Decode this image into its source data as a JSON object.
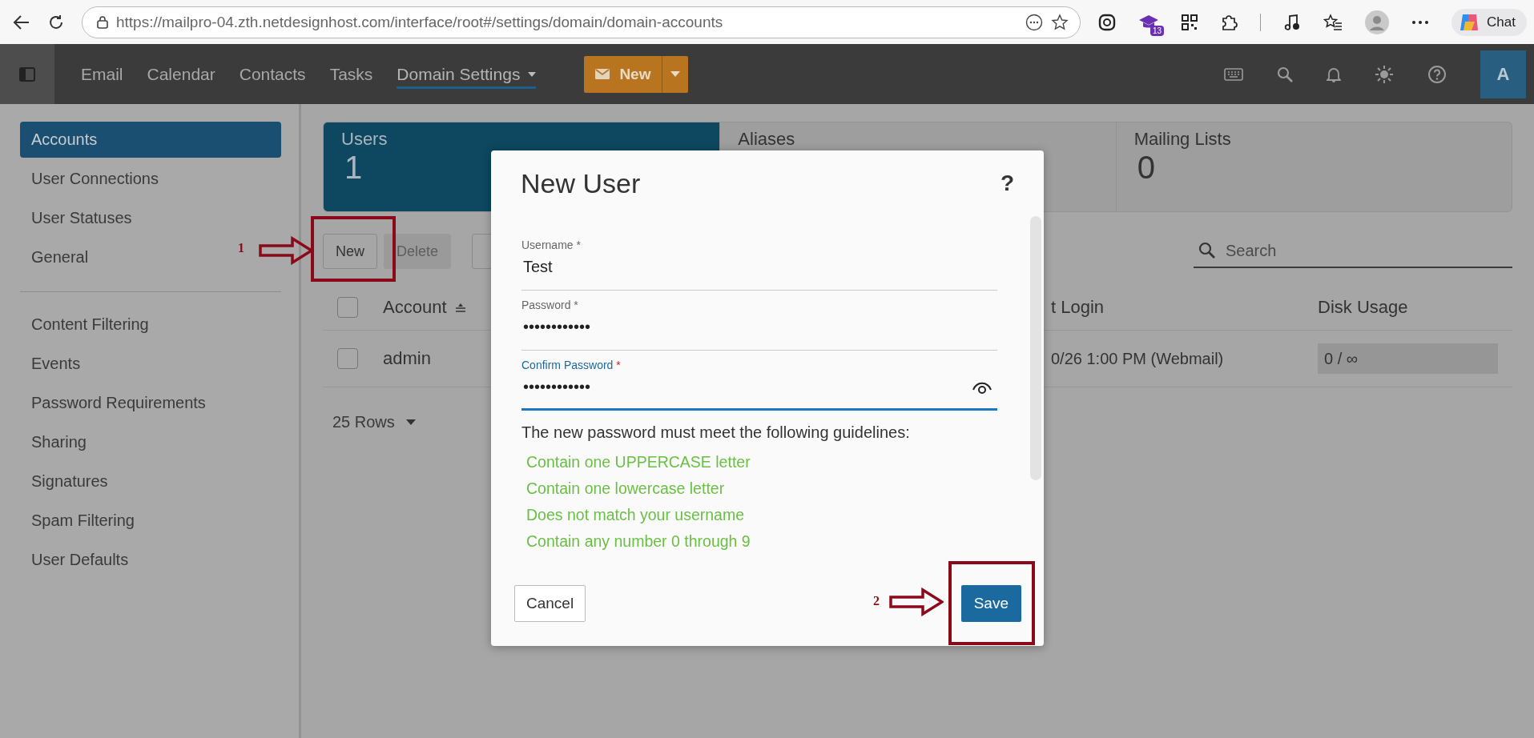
{
  "browser": {
    "url_scheme": "https://",
    "url_host": "mailpro-04.zth.netdesignhost.com",
    "url_path": "/interface/root#/settings/domain/domain-accounts",
    "extension_badge": "13",
    "chat_label": "Chat"
  },
  "nav": {
    "items": [
      {
        "label": "Email",
        "selected": false
      },
      {
        "label": "Calendar",
        "selected": false
      },
      {
        "label": "Contacts",
        "selected": false
      },
      {
        "label": "Tasks",
        "selected": false
      },
      {
        "label": "Domain Settings",
        "selected": true
      }
    ],
    "new_button": "New",
    "avatar": "A"
  },
  "sidebar": {
    "groups": [
      [
        {
          "label": "Accounts",
          "selected": true
        },
        {
          "label": "User Connections",
          "selected": false
        },
        {
          "label": "User Statuses",
          "selected": false
        },
        {
          "label": "General",
          "selected": false
        }
      ],
      [
        {
          "label": "Content Filtering",
          "selected": false
        },
        {
          "label": "Events",
          "selected": false
        },
        {
          "label": "Password Requirements",
          "selected": false
        },
        {
          "label": "Sharing",
          "selected": false
        },
        {
          "label": "Signatures",
          "selected": false
        },
        {
          "label": "Spam Filtering",
          "selected": false
        },
        {
          "label": "User Defaults",
          "selected": false
        }
      ]
    ]
  },
  "stats": [
    {
      "label": "Users",
      "value": "1",
      "selected": true
    },
    {
      "label": "Aliases",
      "selected": false
    },
    {
      "label": "Mailing Lists",
      "value": "0",
      "selected": false
    }
  ],
  "toolbar": {
    "buttons": [
      {
        "label": "New",
        "disabled": false
      },
      {
        "label": "Delete",
        "disabled": true
      }
    ],
    "search": {
      "placeholder": "Search"
    }
  },
  "table": {
    "header_checked": false,
    "columns": [
      {
        "label": "Account",
        "sorted": true
      },
      {
        "label": "t Login",
        "sorted": false
      },
      {
        "label": "Disk Usage",
        "sorted": false
      }
    ],
    "rows": [
      {
        "checked": false,
        "cells": [
          "admin",
          "0/26 1:00 PM (Webmail)",
          "0 / ∞"
        ]
      }
    ],
    "rows_per_page": "25 Rows"
  },
  "dialog": {
    "title": "New User",
    "help": "?",
    "fields": [
      {
        "label": "Username",
        "required_mark": "*",
        "value": "Test",
        "focused": false,
        "reveal": false
      },
      {
        "label": "Password",
        "required_mark": "*",
        "value": "••••••••••••",
        "focused": false,
        "reveal": false
      },
      {
        "label": "Confirm Password",
        "required_mark": "*",
        "value": "••••••••••••",
        "focused": true,
        "reveal": true
      }
    ],
    "guideline_intro": "The new password must meet the following guidelines:",
    "guidelines": [
      {
        "text": "Contain one UPPERCASE letter",
        "met": true
      },
      {
        "text": "Contain one lowercase letter",
        "met": true
      },
      {
        "text": "Does not match your username",
        "met": true
      },
      {
        "text": "Contain any number 0 through 9",
        "met": true
      }
    ],
    "cancel": "Cancel",
    "save": "Save"
  },
  "annotations": [
    {
      "number": "1"
    },
    {
      "number": "2"
    }
  ]
}
